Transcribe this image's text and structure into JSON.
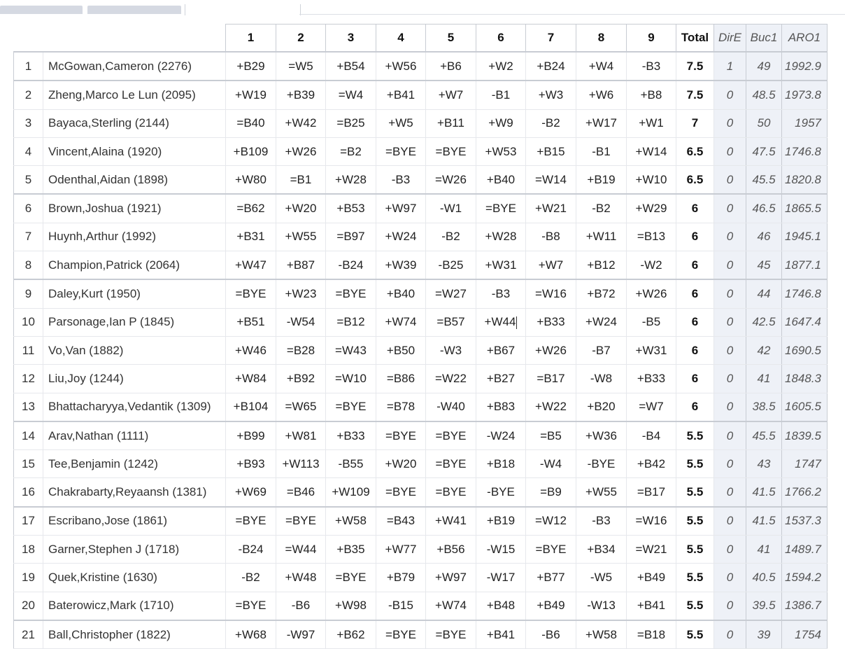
{
  "header": {
    "rounds": [
      "1",
      "2",
      "3",
      "4",
      "5",
      "6",
      "7",
      "8",
      "9"
    ],
    "total": "Total",
    "tiebreaks": [
      "DirE",
      "Buc1",
      "ARO1"
    ]
  },
  "rows": [
    {
      "rank": "1",
      "name": "McGowan,Cameron (2276)",
      "results": [
        "+B29",
        "=W5",
        "+B54",
        "+W56",
        "+B6",
        "+W2",
        "+B24",
        "+W4",
        "-B3"
      ],
      "total": "7.5",
      "dire": "1",
      "buc1": "49",
      "aro1": "1992.9"
    },
    {
      "rank": "2",
      "name": "Zheng,Marco Le Lun (2095)",
      "results": [
        "+W19",
        "+B39",
        "=W4",
        "+B41",
        "+W7",
        "-B1",
        "+W3",
        "+W6",
        "+B8"
      ],
      "total": "7.5",
      "dire": "0",
      "buc1": "48.5",
      "aro1": "1973.8"
    },
    {
      "rank": "3",
      "name": "Bayaca,Sterling (2144)",
      "results": [
        "=B40",
        "+W42",
        "=B25",
        "+W5",
        "+B11",
        "+W9",
        "-B2",
        "+W17",
        "+W1"
      ],
      "total": "7",
      "dire": "0",
      "buc1": "50",
      "aro1": "1957"
    },
    {
      "rank": "4",
      "name": "Vincent,Alaina (1920)",
      "results": [
        "+B109",
        "+W26",
        "=B2",
        "=BYE",
        "=BYE",
        "+W53",
        "+B15",
        "-B1",
        "+W14"
      ],
      "total": "6.5",
      "dire": "0",
      "buc1": "47.5",
      "aro1": "1746.8"
    },
    {
      "rank": "5",
      "name": "Odenthal,Aidan (1898)",
      "results": [
        "+W80",
        "=B1",
        "+W28",
        "-B3",
        "=W26",
        "+B40",
        "=W14",
        "+B19",
        "+W10"
      ],
      "total": "6.5",
      "dire": "0",
      "buc1": "45.5",
      "aro1": "1820.8"
    },
    {
      "rank": "6",
      "name": "Brown,Joshua (1921)",
      "results": [
        "=B62",
        "+W20",
        "+B53",
        "+W97",
        "-W1",
        "=BYE",
        "+W21",
        "-B2",
        "+W29"
      ],
      "total": "6",
      "dire": "0",
      "buc1": "46.5",
      "aro1": "1865.5"
    },
    {
      "rank": "7",
      "name": "Huynh,Arthur (1992)",
      "results": [
        "+B31",
        "+W55",
        "=B97",
        "+W24",
        "-B2",
        "+W28",
        "-B8",
        "+W11",
        "=B13"
      ],
      "total": "6",
      "dire": "0",
      "buc1": "46",
      "aro1": "1945.1"
    },
    {
      "rank": "8",
      "name": "Champion,Patrick (2064)",
      "results": [
        "+W47",
        "+B87",
        "-B24",
        "+W39",
        "-B25",
        "+W31",
        "+W7",
        "+B12",
        "-W2"
      ],
      "total": "6",
      "dire": "0",
      "buc1": "45",
      "aro1": "1877.1"
    },
    {
      "rank": "9",
      "name": "Daley,Kurt (1950)",
      "results": [
        "=BYE",
        "+W23",
        "=BYE",
        "+B40",
        "=W27",
        "-B3",
        "=W16",
        "+B72",
        "+W26"
      ],
      "total": "6",
      "dire": "0",
      "buc1": "44",
      "aro1": "1746.8"
    },
    {
      "rank": "10",
      "name": "Parsonage,Ian P (1845)",
      "results": [
        "+B51",
        "-W54",
        "=B12",
        "+W74",
        "=B57",
        "+W44",
        "+B33",
        "+W24",
        "-B5"
      ],
      "total": "6",
      "dire": "0",
      "buc1": "42.5",
      "aro1": "1647.4"
    },
    {
      "rank": "11",
      "name": "Vo,Van (1882)",
      "results": [
        "+W46",
        "=B28",
        "=W43",
        "+B50",
        "-W3",
        "+B67",
        "+W26",
        "-B7",
        "+W31"
      ],
      "total": "6",
      "dire": "0",
      "buc1": "42",
      "aro1": "1690.5"
    },
    {
      "rank": "12",
      "name": "Liu,Joy (1244)",
      "results": [
        "+W84",
        "+B92",
        "=W10",
        "=B86",
        "=W22",
        "+B27",
        "=B17",
        "-W8",
        "+B33"
      ],
      "total": "6",
      "dire": "0",
      "buc1": "41",
      "aro1": "1848.3"
    },
    {
      "rank": "13",
      "name": "Bhattacharyya,Vedantik (1309)",
      "results": [
        "+B104",
        "=W65",
        "=BYE",
        "=B78",
        "-W40",
        "+B83",
        "+W22",
        "+B20",
        "=W7"
      ],
      "total": "6",
      "dire": "0",
      "buc1": "38.5",
      "aro1": "1605.5"
    },
    {
      "rank": "14",
      "name": "Arav,Nathan (1111)",
      "results": [
        "+B99",
        "+W81",
        "+B33",
        "=BYE",
        "=BYE",
        "-W24",
        "=B5",
        "+W36",
        "-B4"
      ],
      "total": "5.5",
      "dire": "0",
      "buc1": "45.5",
      "aro1": "1839.5"
    },
    {
      "rank": "15",
      "name": "Tee,Benjamin (1242)",
      "results": [
        "+B93",
        "+W113",
        "-B55",
        "+W20",
        "=BYE",
        "+B18",
        "-W4",
        "-BYE",
        "+B42"
      ],
      "total": "5.5",
      "dire": "0",
      "buc1": "43",
      "aro1": "1747"
    },
    {
      "rank": "16",
      "name": "Chakrabarty,Reyaansh (1381)",
      "results": [
        "+W69",
        "=B46",
        "+W109",
        "=BYE",
        "=BYE",
        "-BYE",
        "=B9",
        "+W55",
        "=B17"
      ],
      "total": "5.5",
      "dire": "0",
      "buc1": "41.5",
      "aro1": "1766.2"
    },
    {
      "rank": "17",
      "name": "Escribano,Jose (1861)",
      "results": [
        "=BYE",
        "=BYE",
        "+W58",
        "=B43",
        "+W41",
        "+B19",
        "=W12",
        "-B3",
        "=W16"
      ],
      "total": "5.5",
      "dire": "0",
      "buc1": "41.5",
      "aro1": "1537.3"
    },
    {
      "rank": "18",
      "name": "Garner,Stephen J (1718)",
      "results": [
        "-B24",
        "=W44",
        "+B35",
        "+W77",
        "+B56",
        "-W15",
        "=BYE",
        "+B34",
        "=W21"
      ],
      "total": "5.5",
      "dire": "0",
      "buc1": "41",
      "aro1": "1489.7"
    },
    {
      "rank": "19",
      "name": "Quek,Kristine (1630)",
      "results": [
        "-B2",
        "+W48",
        "=BYE",
        "+B79",
        "+W97",
        "-W17",
        "+B77",
        "-W5",
        "+B49"
      ],
      "total": "5.5",
      "dire": "0",
      "buc1": "40.5",
      "aro1": "1594.2"
    },
    {
      "rank": "20",
      "name": "Baterowicz,Mark (1710)",
      "results": [
        "=BYE",
        "-B6",
        "+W98",
        "-B15",
        "+W74",
        "+B48",
        "+B49",
        "-W13",
        "+B41"
      ],
      "total": "5.5",
      "dire": "0",
      "buc1": "39.5",
      "aro1": "1386.7"
    },
    {
      "rank": "21",
      "name": "Ball,Christopher (1822)",
      "results": [
        "+W68",
        "-W97",
        "+B62",
        "=BYE",
        "=BYE",
        "+B41",
        "-B6",
        "+W58",
        "=B18"
      ],
      "total": "5.5",
      "dire": "0",
      "buc1": "39",
      "aro1": "1754"
    }
  ]
}
